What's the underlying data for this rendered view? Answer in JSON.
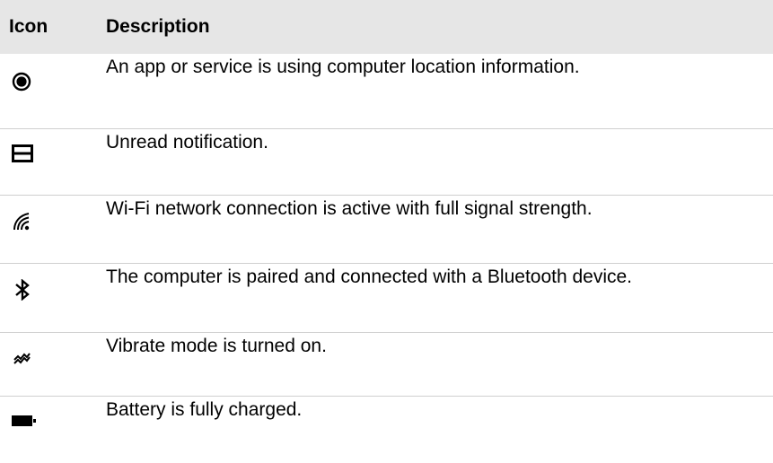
{
  "table": {
    "header": {
      "icon": "Icon",
      "description": "Description"
    },
    "rows": [
      {
        "icon": "location-icon",
        "description": "An app or service is using computer location information."
      },
      {
        "icon": "notification-icon",
        "description": "Unread notification."
      },
      {
        "icon": "wifi-icon",
        "description": "Wi-Fi network connection is active with full signal strength."
      },
      {
        "icon": "bluetooth-icon",
        "description": "The computer is paired and connected with a Bluetooth device."
      },
      {
        "icon": "vibrate-icon",
        "description": "Vibrate mode is turned on."
      },
      {
        "icon": "battery-full-icon",
        "description": "Battery is fully charged."
      }
    ]
  }
}
